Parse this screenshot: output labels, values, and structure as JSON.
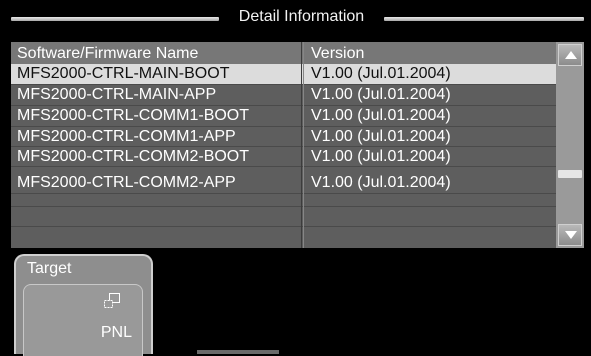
{
  "dialog": {
    "title": "Detail Information"
  },
  "table": {
    "columns": [
      "Software/Firmware Name",
      "Version"
    ],
    "rows": [
      {
        "name": "MFS2000-CTRL-MAIN-BOOT",
        "version": "V1.00 (Jul.01.2004)",
        "selected": true
      },
      {
        "name": "MFS2000-CTRL-MAIN-APP",
        "version": "V1.00 (Jul.01.2004)"
      },
      {
        "name": "MFS2000-CTRL-COMM1-BOOT",
        "version": "V1.00 (Jul.01.2004)"
      },
      {
        "name": "MFS2000-CTRL-COMM1-APP",
        "version": "V1.00 (Jul.01.2004)"
      },
      {
        "name": "MFS2000-CTRL-COMM2-BOOT",
        "version": "V1.00 (Jul.01.2004)"
      },
      {
        "name": "MFS2000-CTRL-COMM2-APP",
        "version": "V1.00 (Jul.01.2004)"
      }
    ]
  },
  "scrollbar": {
    "up_icon": "triangle-up-icon",
    "down_icon": "triangle-down-icon"
  },
  "target": {
    "label": "Target",
    "button_label": "PNL",
    "button_icon": "window-select-icon"
  },
  "colors": {
    "background": "#000000",
    "table": "#5e5e5e",
    "selected_row": "#dcdcdc"
  }
}
